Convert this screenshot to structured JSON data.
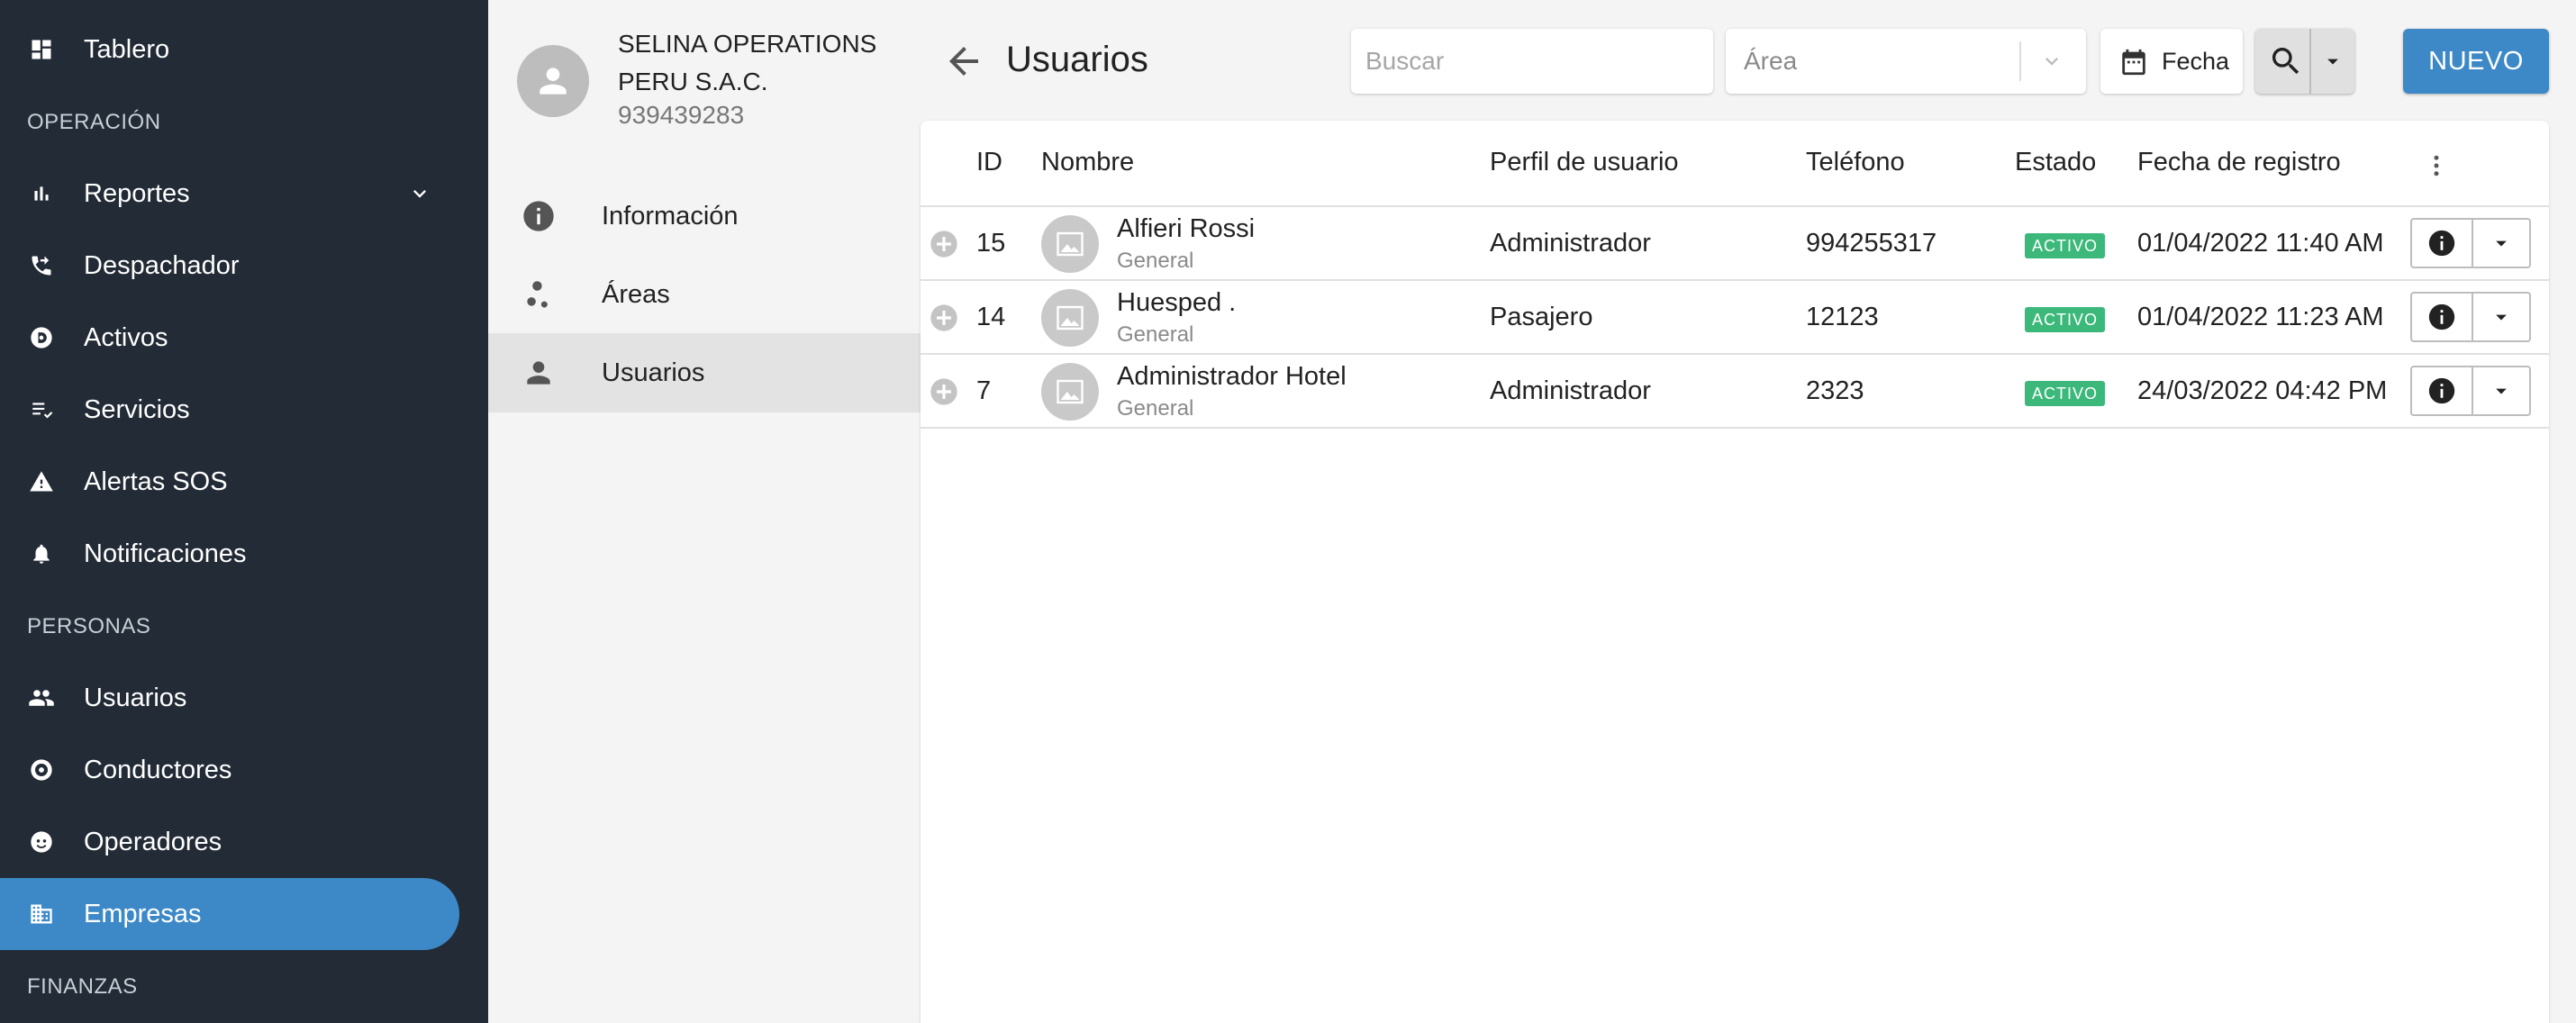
{
  "sidebar": {
    "sections": {
      "operacion": "OPERACIÓN",
      "personas": "PERSONAS",
      "finanzas": "FINANZAS"
    },
    "items": {
      "tablero": "Tablero",
      "reportes": "Reportes",
      "despachador": "Despachador",
      "activos": "Activos",
      "servicios": "Servicios",
      "alertas": "Alertas SOS",
      "notificaciones": "Notificaciones",
      "usuarios": "Usuarios",
      "conductores": "Conductores",
      "operadores": "Operadores",
      "empresas": "Empresas"
    },
    "active_item": "Empresas"
  },
  "company": {
    "name": "SELINA OPERATIONS PERU S.A.C.",
    "phone": "939439283",
    "menu": {
      "informacion": "Información",
      "areas": "Áreas",
      "usuarios": "Usuarios"
    },
    "active_menu": "Usuarios"
  },
  "toolbar": {
    "title": "Usuarios",
    "search_placeholder": "Buscar",
    "area_placeholder": "Área",
    "date_label": "Fecha",
    "new_label": "NUEVO"
  },
  "table": {
    "columns": {
      "id": "ID",
      "name": "Nombre",
      "profile": "Perfil de usuario",
      "phone": "Teléfono",
      "status": "Estado",
      "date": "Fecha de registro"
    },
    "rows": [
      {
        "id": "15",
        "name": "Alfieri Rossi",
        "area": "General",
        "profile": "Administrador",
        "phone": "994255317",
        "status": "ACTIVO",
        "date": "01/04/2022 11:40 AM"
      },
      {
        "id": "14",
        "name": "Huesped .",
        "area": "General",
        "profile": "Pasajero",
        "phone": "12123",
        "status": "ACTIVO",
        "date": "01/04/2022 11:23 AM"
      },
      {
        "id": "7",
        "name": "Administrador Hotel",
        "area": "General",
        "profile": "Administrador",
        "phone": "2323",
        "status": "ACTIVO",
        "date": "24/03/2022 04:42 PM"
      }
    ]
  },
  "colors": {
    "sidebar_bg": "#222b36",
    "accent": "#3d89c8",
    "status_active": "#3cb97a"
  }
}
